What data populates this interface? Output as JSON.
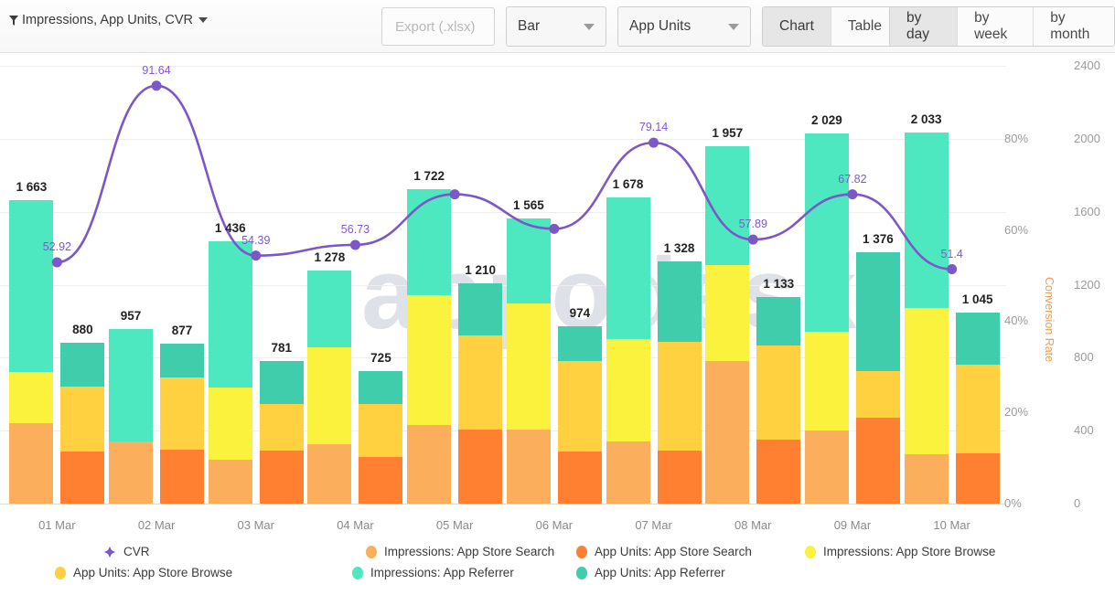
{
  "toolbar": {
    "filter_title": "Impressions, App Units, CVR",
    "filter_icon": "funnel-icon",
    "caret_icon": "chevron-down-icon",
    "export_label": "Export (.xlsx)",
    "chart_type_value": "Bar",
    "metric_value": "App Units",
    "view_chart": "Chart",
    "view_table": "Table",
    "gran_day": "by day",
    "gran_week": "by week",
    "gran_month": "by month",
    "active_view": "Chart",
    "active_gran": "by day"
  },
  "watermark": "appodesk",
  "colors": {
    "impressions_search": "#FBAE5C",
    "app_units_search": "#FF8030",
    "impressions_browse": "#FAF23C",
    "app_units_browse": "#FFD040",
    "impressions_referrer": "#4EE8C0",
    "app_units_referrer": "#40CDAC",
    "cvr": "#7B57C8",
    "axis_right_title": "#F79A4A"
  },
  "chart_data": {
    "type": "bar",
    "title": "",
    "xlabel": "",
    "ylabel": "",
    "stacked": true,
    "grid": true,
    "legend_position": "bottom",
    "categories": [
      "01 Mar",
      "02 Mar",
      "03 Mar",
      "04 Mar",
      "05 Mar",
      "06 Mar",
      "07 Mar",
      "08 Mar",
      "09 Mar",
      "10 Mar"
    ],
    "y_left_label": "Conversion Rate",
    "y_left_ticks": [
      "0%",
      "20%",
      "40%",
      "60%",
      "80%"
    ],
    "y_left_values": [
      0,
      20,
      40,
      60,
      80
    ],
    "y_left_lim": [
      0,
      100
    ],
    "y_right_ticks": [
      "0",
      "400",
      "800",
      "1200",
      "1600",
      "2000",
      "2400"
    ],
    "y_right_values": [
      0,
      400,
      800,
      1200,
      1600,
      2000,
      2400
    ],
    "y_right_lim": [
      0,
      2400
    ],
    "y_right_title": "Conversion Rate",
    "series": [
      {
        "name": "Impressions: App Store Search",
        "group": "impressions",
        "color": "#FBAE5C",
        "values": [
          440,
          340,
          240,
          325,
          430,
          405,
          340,
          780,
          400,
          270
        ]
      },
      {
        "name": "Impressions: App Store Browse",
        "group": "impressions",
        "color": "#FAF23C",
        "values": [
          280,
          0,
          395,
          530,
          710,
          690,
          560,
          530,
          540,
          800
        ]
      },
      {
        "name": "Impressions: App Referrer",
        "group": "impressions",
        "color": "#4EE8C0",
        "values": [
          943,
          617,
          801,
          423,
          582,
          470,
          778,
          647,
          1089,
          963
        ]
      },
      {
        "name": "App Units: App Store Search",
        "group": "app_units",
        "color": "#FF8030",
        "values": [
          288,
          298,
          292,
          256,
          404,
          288,
          290,
          352,
          470,
          274
        ]
      },
      {
        "name": "App Units: App Store Browse",
        "group": "app_units",
        "color": "#FFD040",
        "values": [
          352,
          394,
          256,
          288,
          518,
          494,
          598,
          516,
          256,
          486
        ]
      },
      {
        "name": "App Units: App Referrer",
        "group": "app_units",
        "color": "#40CDAC",
        "values": [
          240,
          185,
          233,
          181,
          288,
          192,
          440,
          265,
          650,
          285
        ]
      }
    ],
    "impressions_totals": [
      "1 663",
      "957",
      "1 436",
      "1 278",
      "1 722",
      "1 565",
      "1 678",
      "1 957",
      "2 029",
      "2 033"
    ],
    "app_units_totals": [
      "880",
      "877",
      "781",
      "725",
      "1 210",
      "974",
      "1 328",
      "1 133",
      "1 376",
      "1 045"
    ],
    "cvr_line": {
      "name": "CVR",
      "color": "#7B57C8",
      "labels": [
        "52.92",
        "91.64",
        "54.39",
        "56.73",
        "67.82",
        "60.25",
        "79.14",
        "57.89",
        "67.82",
        "51.4"
      ],
      "values": [
        52.92,
        91.64,
        54.39,
        56.73,
        67.82,
        60.25,
        79.14,
        57.89,
        67.82,
        51.4
      ],
      "point_labels": [
        "52.92",
        "91.64",
        "54.39",
        "56.73",
        "",
        "",
        "79.14",
        "57.89",
        "67.82",
        "51.4"
      ]
    }
  },
  "legend": [
    {
      "label": "CVR",
      "color": "#7B57C8",
      "shape": "cross"
    },
    {
      "label": "Impressions: App Store Search",
      "color": "#FBAE5C",
      "shape": "dot"
    },
    {
      "label": "App Units: App Store Search",
      "color": "#FF8030",
      "shape": "dot"
    },
    {
      "label": "Impressions: App Store Browse",
      "color": "#FAF23C",
      "shape": "dot"
    },
    {
      "label": "App Units: App Store Browse",
      "color": "#FFD040",
      "shape": "dot"
    },
    {
      "label": "Impressions: App Referrer",
      "color": "#4EE8C0",
      "shape": "dot"
    },
    {
      "label": "App Units: App Referrer",
      "color": "#40CDAC",
      "shape": "dot"
    }
  ]
}
